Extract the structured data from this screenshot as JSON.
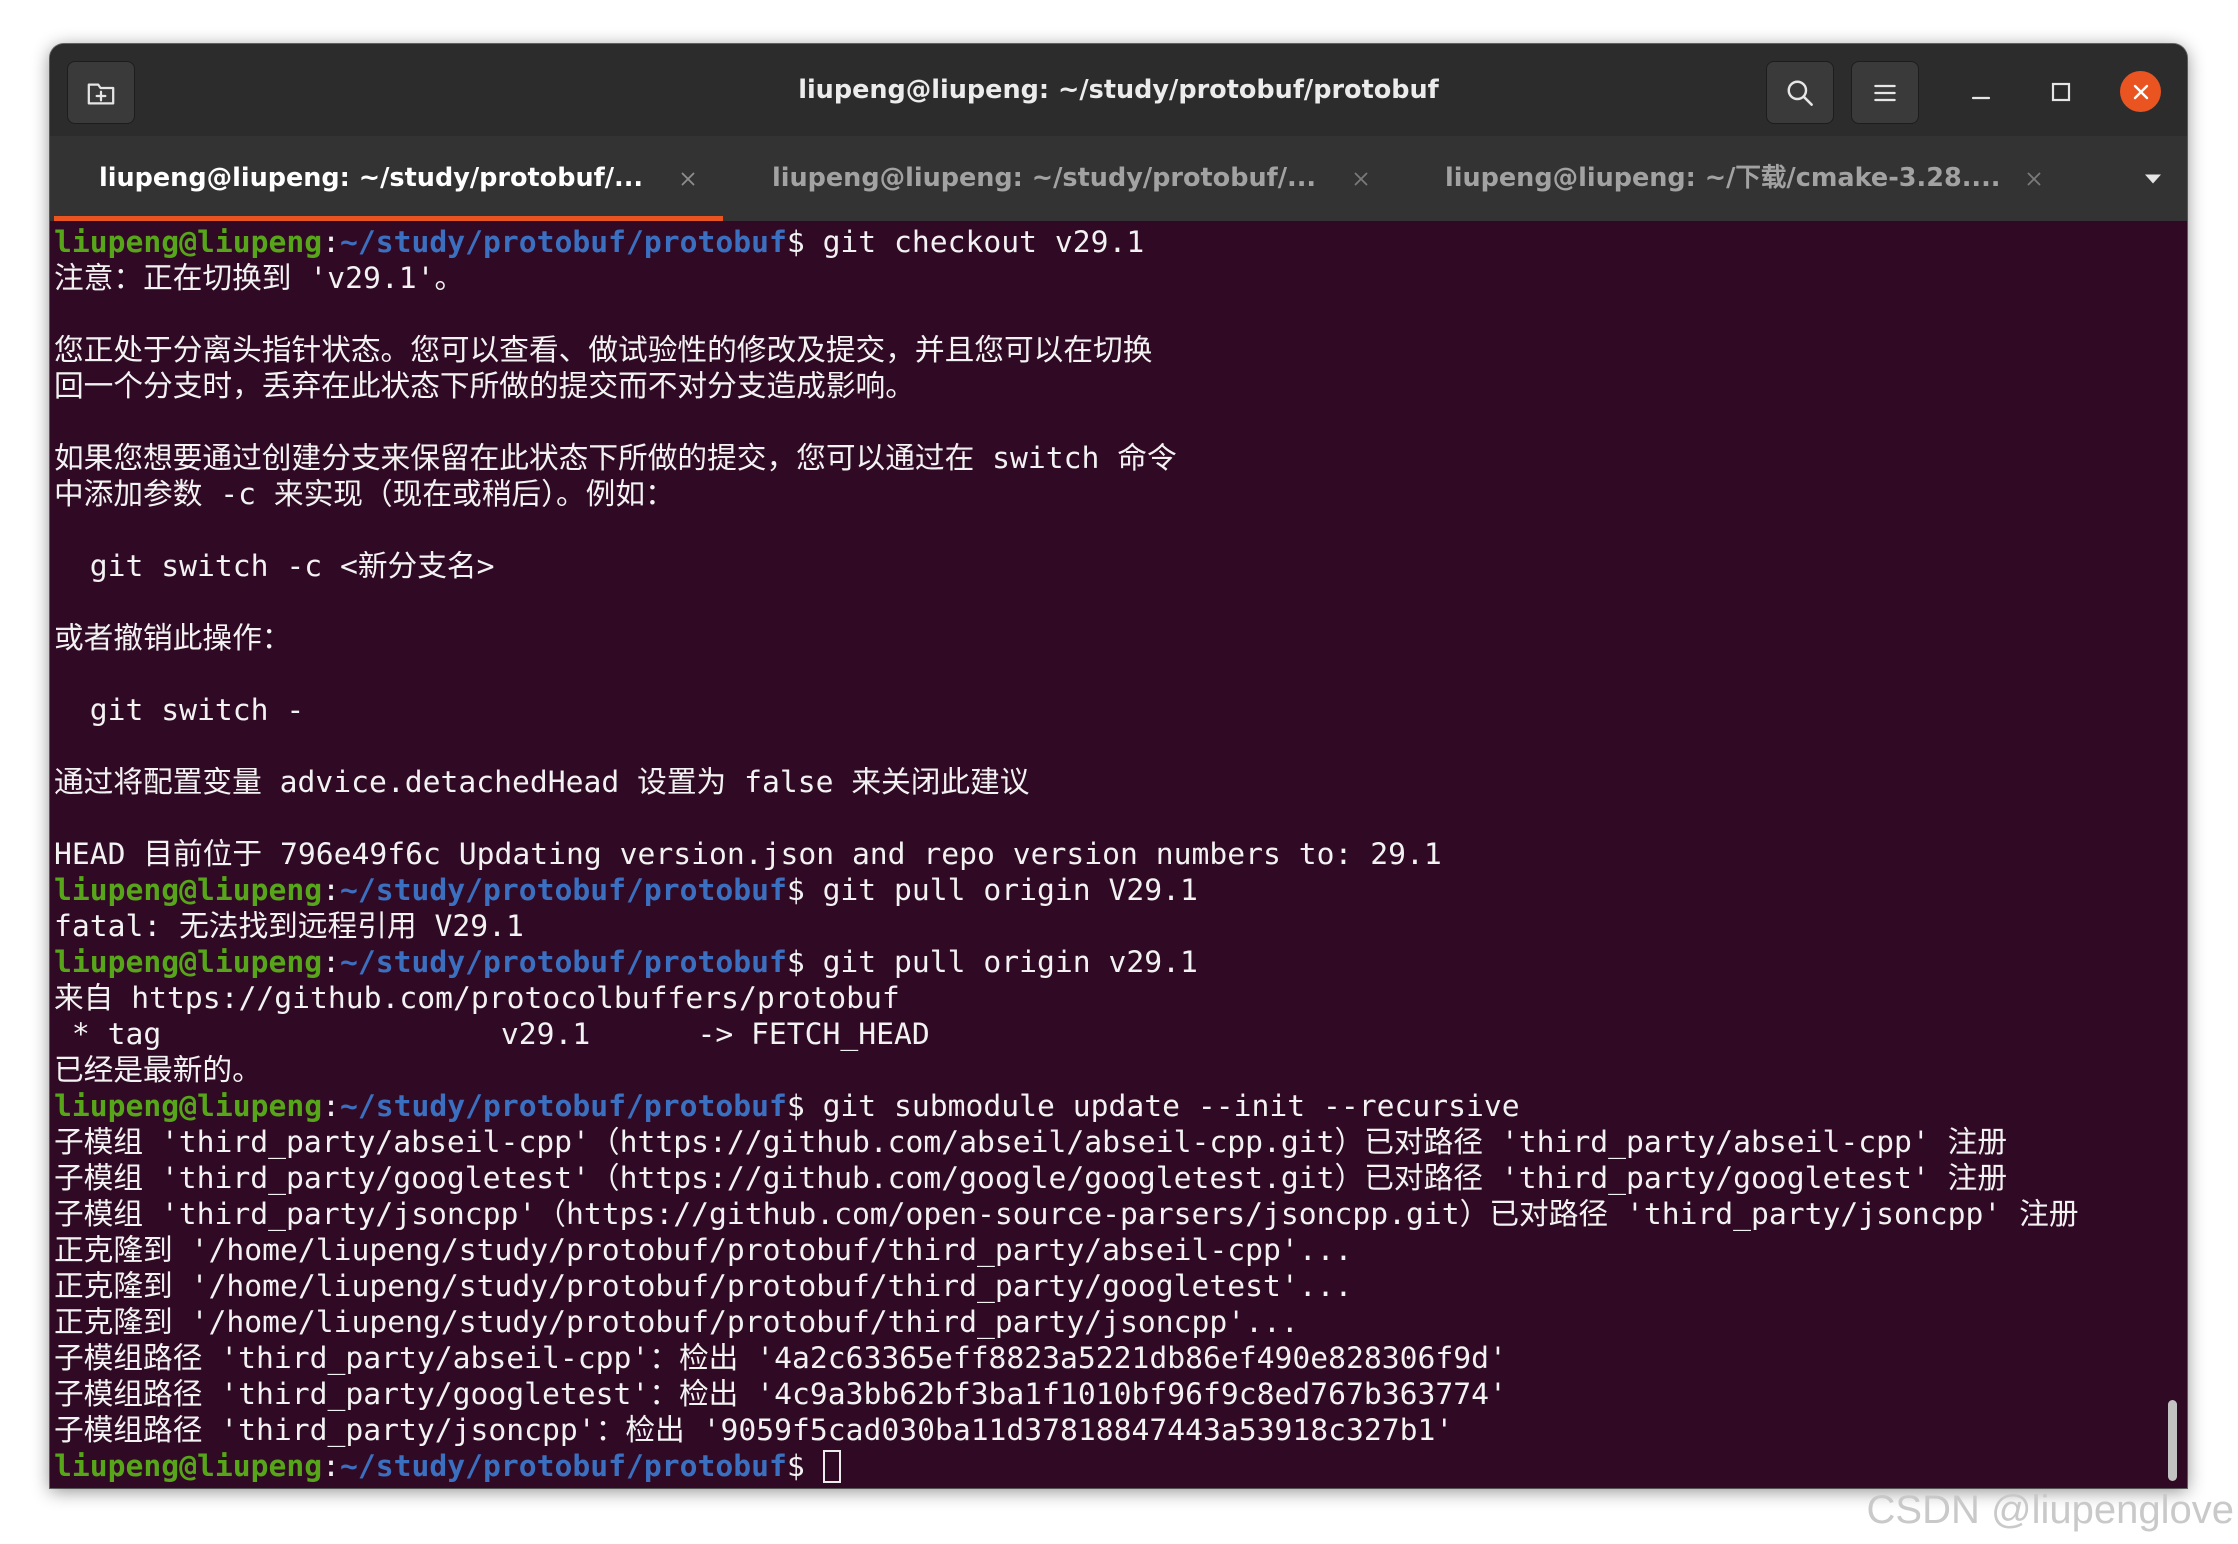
{
  "window": {
    "title": "liupeng@liupeng: ~/study/protobuf/protobuf"
  },
  "icons": {
    "new_tab": "new-tab-icon",
    "search": "search-icon",
    "menu": "hamburger-menu-icon",
    "minimize": "minimize-icon",
    "maximize": "maximize-icon",
    "close": "close-icon",
    "tab_close": "close-tab-icon",
    "tab_list": "chevron-down-icon"
  },
  "tabs": [
    {
      "label": "liupeng@liupeng: ~/study/protobuf/...",
      "active": true
    },
    {
      "label": "liupeng@liupeng: ~/study/protobuf/...",
      "active": false
    },
    {
      "label": "liupeng@liupeng: ~/下载/cmake-3.28....",
      "active": false
    }
  ],
  "prompt": {
    "user_host": "liupeng@liupeng",
    "separator": ":",
    "path": "~/study/protobuf/protobuf",
    "symbol": "$"
  },
  "terminal": {
    "lines": [
      {
        "cmd": "git checkout v29.1"
      },
      {
        "text": "注意：正在切换到 'v29.1'。"
      },
      {
        "text": ""
      },
      {
        "text": "您正处于分离头指针状态。您可以查看、做试验性的修改及提交，并且您可以在切换"
      },
      {
        "text": "回一个分支时，丢弃在此状态下所做的提交而不对分支造成影响。"
      },
      {
        "text": ""
      },
      {
        "text": "如果您想要通过创建分支来保留在此状态下所做的提交，您可以通过在 switch 命令"
      },
      {
        "text": "中添加参数 -c 来实现（现在或稍后）。例如："
      },
      {
        "text": ""
      },
      {
        "text": "  git switch -c <新分支名>"
      },
      {
        "text": ""
      },
      {
        "text": "或者撤销此操作："
      },
      {
        "text": ""
      },
      {
        "text": "  git switch -"
      },
      {
        "text": ""
      },
      {
        "text": "通过将配置变量 advice.detachedHead 设置为 false 来关闭此建议"
      },
      {
        "text": ""
      },
      {
        "text": "HEAD 目前位于 796e49f6c Updating version.json and repo version numbers to: 29.1"
      },
      {
        "cmd": "git pull origin V29.1"
      },
      {
        "text": "fatal: 无法找到远程引用 V29.1"
      },
      {
        "cmd": "git pull origin v29.1"
      },
      {
        "text": "来自 https://github.com/protocolbuffers/protobuf"
      },
      {
        "text": " * tag                   v29.1      -> FETCH_HEAD"
      },
      {
        "text": "已经是最新的。"
      },
      {
        "cmd": "git submodule update --init --recursive"
      },
      {
        "text": "子模组 'third_party/abseil-cpp'（https://github.com/abseil/abseil-cpp.git）已对路径 'third_party/abseil-cpp' 注册"
      },
      {
        "text": "子模组 'third_party/googletest'（https://github.com/google/googletest.git）已对路径 'third_party/googletest' 注册"
      },
      {
        "text": "子模组 'third_party/jsoncpp'（https://github.com/open-source-parsers/jsoncpp.git）已对路径 'third_party/jsoncpp' 注册"
      },
      {
        "text": "正克隆到 '/home/liupeng/study/protobuf/protobuf/third_party/abseil-cpp'..."
      },
      {
        "text": "正克隆到 '/home/liupeng/study/protobuf/protobuf/third_party/googletest'..."
      },
      {
        "text": "正克隆到 '/home/liupeng/study/protobuf/protobuf/third_party/jsoncpp'..."
      },
      {
        "text": "子模组路径 'third_party/abseil-cpp'：检出 '4a2c63365eff8823a5221db86ef490e828306f9d'"
      },
      {
        "text": "子模组路径 'third_party/googletest'：检出 '4c9a3bb62bf3ba1f1010bf96f9c8ed767b363774'"
      },
      {
        "text": "子模组路径 'third_party/jsoncpp'：检出 '9059f5cad030ba11d37818847443a53918c327b1'"
      },
      {
        "cmd": ""
      }
    ]
  },
  "colors": {
    "terminal_bg": "#300a24",
    "terminal_fg": "#f2f2f2",
    "titlebar_bg": "#2c2c2c",
    "tabbar_bg": "#333333",
    "prompt_user": "#57a61a",
    "prompt_path": "#3b6fc0",
    "accent": "#e95420"
  },
  "watermark": "CSDN @liupenglove"
}
